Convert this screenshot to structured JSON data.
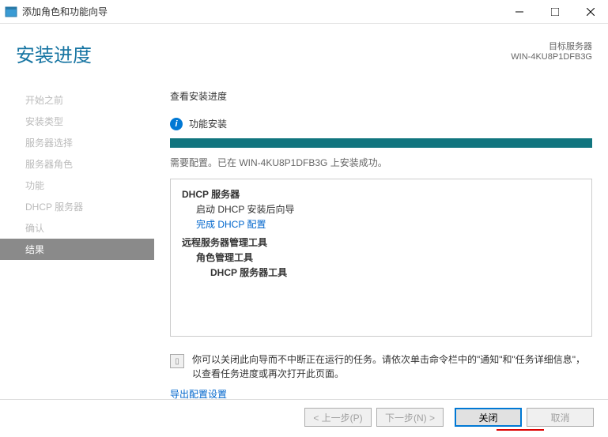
{
  "titlebar": {
    "title": "添加角色和功能向导"
  },
  "header": {
    "title": "安装进度",
    "target_label": "目标服务器",
    "target_value": "WIN-4KU8P1DFB3G"
  },
  "sidebar": {
    "items": [
      {
        "label": "开始之前"
      },
      {
        "label": "安装类型"
      },
      {
        "label": "服务器选择"
      },
      {
        "label": "服务器角色"
      },
      {
        "label": "功能"
      },
      {
        "label": "DHCP 服务器"
      },
      {
        "label": "确认"
      },
      {
        "label": "结果"
      }
    ]
  },
  "main": {
    "section_title": "查看安装进度",
    "status_label": "功能安装",
    "progress_status": "需要配置。已在 WIN-4KU8P1DFB3G 上安装成功。",
    "results": {
      "group1_title": "DHCP 服务器",
      "group1_sub1": "启动 DHCP 安装后向导",
      "group1_link": "完成 DHCP 配置",
      "group2_title": "远程服务器管理工具",
      "group2_sub1": "角色管理工具",
      "group2_sub2": "DHCP 服务器工具"
    },
    "note_text": "你可以关闭此向导而不中断正在运行的任务。请依次单击命令栏中的\"通知\"和\"任务详细信息\"，以查看任务进度或再次打开此页面。",
    "export_link": "导出配置设置"
  },
  "footer": {
    "prev": "< 上一步(P)",
    "next": "下一步(N) >",
    "close": "关闭",
    "cancel": "取消"
  }
}
